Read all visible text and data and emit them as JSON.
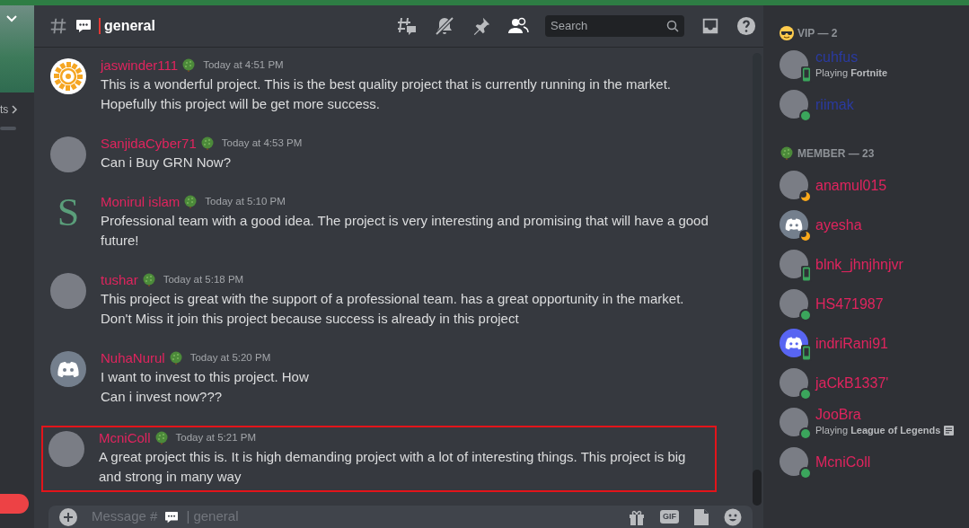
{
  "server_sidebar": {
    "partial_label": "ts"
  },
  "header": {
    "channel": "general",
    "search": {
      "placeholder": "Search"
    }
  },
  "messages": [
    {
      "author": "jaswinder111",
      "tree_badge": true,
      "time": "Today at 4:51 PM",
      "avatar": {
        "kind": "logo"
      },
      "lines": [
        "This is a wonderful project. This is the best quality project that is currently running in the market.",
        "Hopefully this project will be get more success."
      ],
      "highlighted": false
    },
    {
      "author": "SanjidaCyber71",
      "tree_badge": true,
      "time": "Today at 4:53 PM",
      "avatar": {
        "kind": "photo"
      },
      "lines": [
        "Can i Buy GRN Now?"
      ],
      "highlighted": false
    },
    {
      "author": "Monirul islam",
      "tree_badge": true,
      "time": "Today at 5:10 PM",
      "avatar": {
        "kind": "letter",
        "letter": "S"
      },
      "lines": [
        "Professional team with a good idea. The project is very interesting and promising that will have a good",
        "future!"
      ],
      "highlighted": false
    },
    {
      "author": "tushar",
      "tree_badge": true,
      "time": "Today at 5:18 PM",
      "avatar": {
        "kind": "photo"
      },
      "lines": [
        "This project is great with the support of a professional team. has a great opportunity in the market.",
        "Don't Miss it join this project because success is already in this project"
      ],
      "highlighted": false
    },
    {
      "author": "NuhaNurul",
      "tree_badge": true,
      "time": "Today at 5:20 PM",
      "avatar": {
        "kind": "default",
        "color": "#747f8d"
      },
      "lines": [
        "I want to invest to this project. How",
        "Can i invest now???"
      ],
      "highlighted": false
    },
    {
      "author": "McniColl",
      "tree_badge": true,
      "time": "Today at 5:21 PM",
      "avatar": {
        "kind": "photo"
      },
      "lines": [
        "A great project this is. It is high demanding project with a lot of interesting things. This project is big",
        "and strong in many way"
      ],
      "highlighted": true
    }
  ],
  "message_input": {
    "placeholder_start": "Message #",
    "placeholder_end": "| general",
    "gif_label": "GIF"
  },
  "member_groups": [
    {
      "title": "VIP — 2",
      "color": "#2a3aa0",
      "members": [
        {
          "name": "cuhfus",
          "presence": {
            "kind": "mobile"
          },
          "avatar": {
            "kind": "photo"
          },
          "activity": "Playing **Fortnite**"
        },
        {
          "name": "riimak",
          "presence": {
            "kind": "online"
          },
          "avatar": {
            "kind": "photo"
          }
        }
      ]
    },
    {
      "title": "MEMBER — 23",
      "color": "#e0245e",
      "members": [
        {
          "name": "anamul015",
          "presence": {
            "kind": "idle"
          },
          "avatar": {
            "kind": "photo"
          }
        },
        {
          "name": "ayesha",
          "presence": {
            "kind": "idle"
          },
          "avatar": {
            "kind": "default",
            "color": "#747f8d"
          }
        },
        {
          "name": "blnk_jhnjhnjvr",
          "presence": {
            "kind": "mobile"
          },
          "avatar": {
            "kind": "photo"
          }
        },
        {
          "name": "HS471987",
          "presence": {
            "kind": "online"
          },
          "avatar": {
            "kind": "photo"
          }
        },
        {
          "name": "indriRani91",
          "presence": {
            "kind": "mobile"
          },
          "avatar": {
            "kind": "default",
            "color": "#5865f2"
          }
        },
        {
          "name": "jaCkB1337'",
          "presence": {
            "kind": "online"
          },
          "avatar": {
            "kind": "photo"
          }
        },
        {
          "name": "JooBra",
          "presence": {
            "kind": "online"
          },
          "avatar": {
            "kind": "photo"
          },
          "activity": "Playing **League of Legends**",
          "details_icon": true
        },
        {
          "name": "McniColl",
          "presence": {
            "kind": "online"
          },
          "avatar": {
            "kind": "photo"
          }
        }
      ]
    }
  ]
}
